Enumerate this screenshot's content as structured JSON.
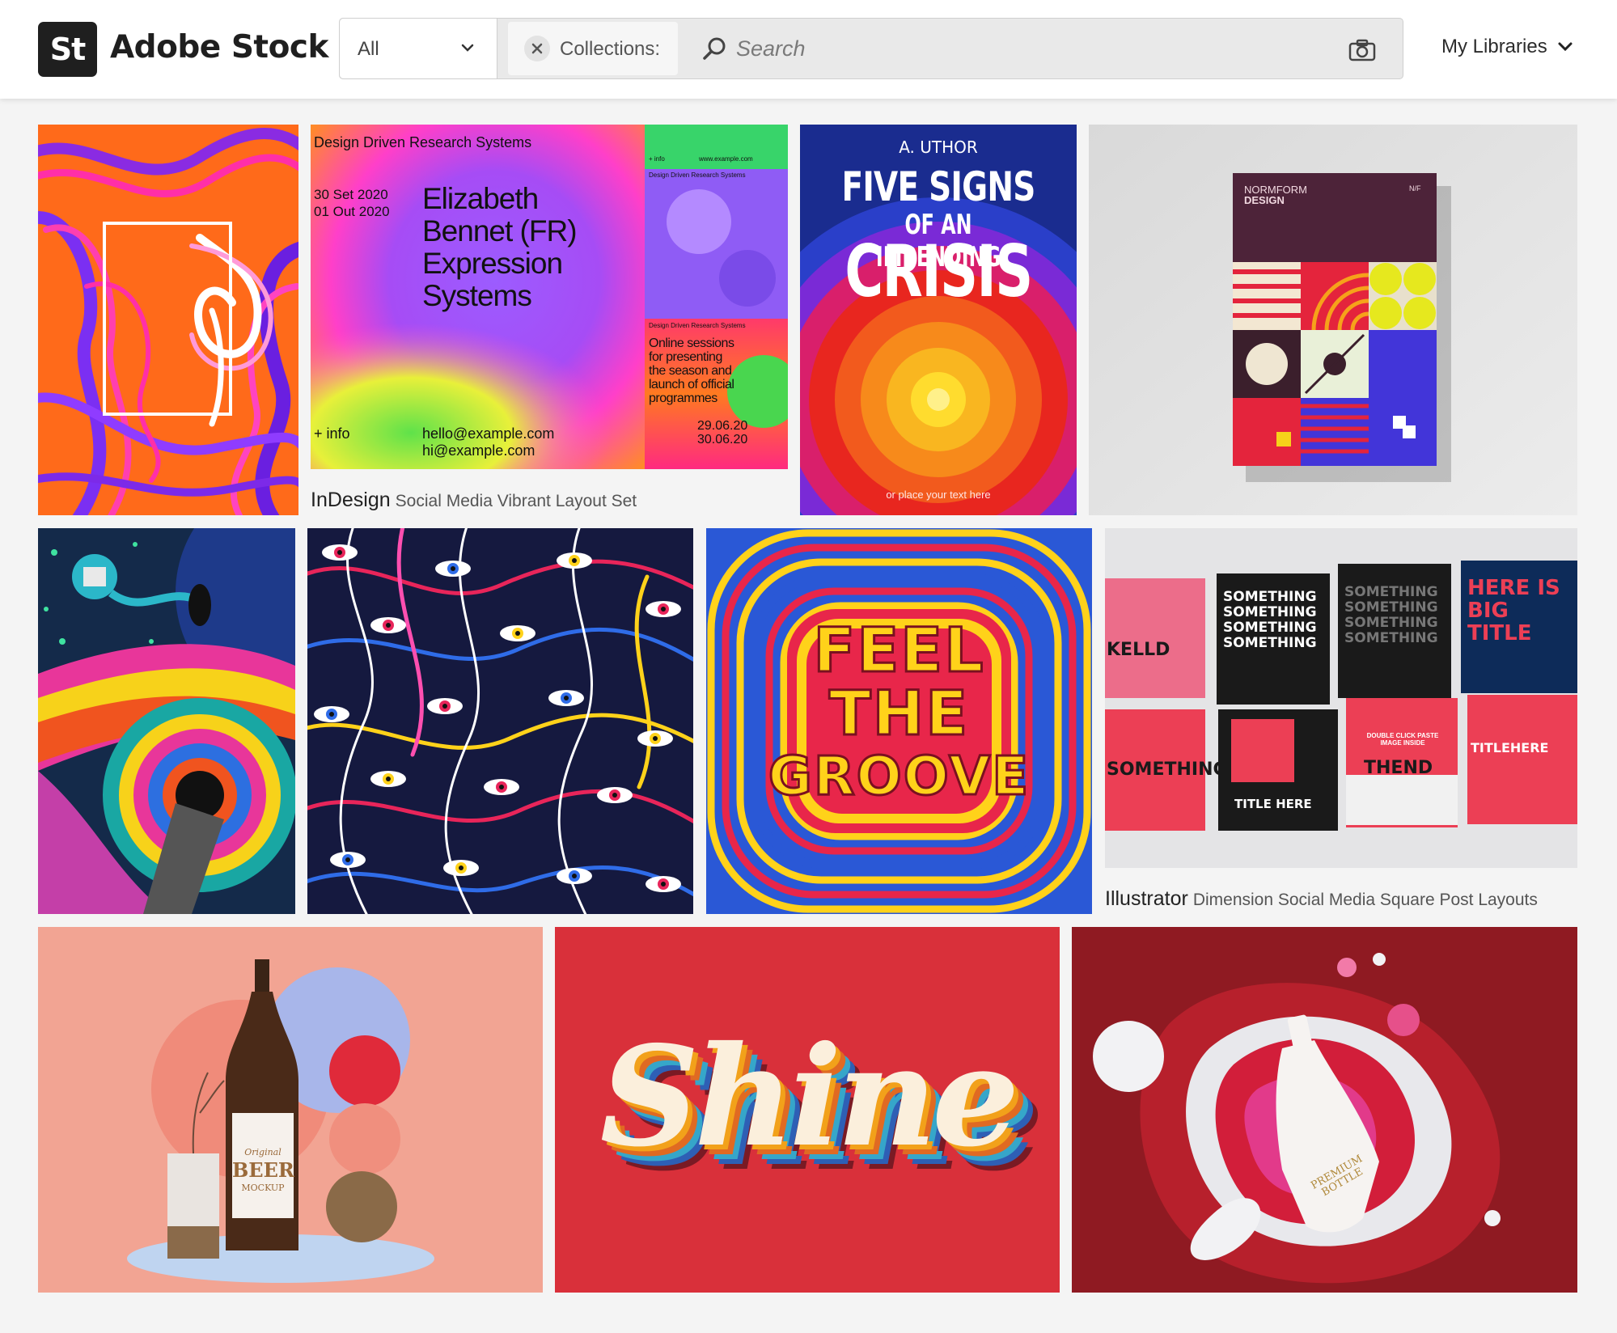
{
  "header": {
    "logo_mark": "St",
    "logo_text": "Adobe Stock",
    "scope_label": "All",
    "chip_label": "Collections:",
    "search_placeholder": "Search",
    "libraries_label": "My Libraries"
  },
  "gallery": {
    "indesign": {
      "app": "InDesign",
      "description": "Social Media Vibrant Layout Set",
      "poster": {
        "header": "Design Driven Research Systems",
        "date1": "30 Set 2020",
        "date2": "01 Out 2020",
        "name_line1": "Elizabeth",
        "name_line2": "Bennet (FR)",
        "name_line3": "Expression",
        "name_line4": "Systems",
        "info": "+ info",
        "email1": "hello@example.com",
        "email2": "hi@example.com",
        "side_small1": "+ info",
        "side_small2": "www.example.com",
        "side_header": "Design Driven Research Systems",
        "side_text1": "Online sessions",
        "side_text2": "for presenting",
        "side_text3": "the season and",
        "side_text4": "launch of official",
        "side_text5": "programmes",
        "side_date1": "29.06.20",
        "side_date2": "30.06.20"
      }
    },
    "crisis": {
      "author": "A. UTHOR",
      "line1": "FIVE SIGNS",
      "line2": "OF AN IMPENDING",
      "line3": "CRISIS",
      "footer": "or place your text here"
    },
    "normform": {
      "title1": "NORMFORM",
      "title2": "DESIGN",
      "tag": "N/F"
    },
    "groove": {
      "line1": "FEEL",
      "line2": "THE",
      "line3": "GROOVE"
    },
    "illustrator": {
      "app": "Illustrator",
      "description": "Dimension Social Media Square Post Layouts",
      "cards": {
        "c1": "KELLD",
        "c2": "SOMETHING",
        "c3": "SOMETHING",
        "c4": "HERE IS BIG TITLE",
        "c5": "SOMETHING",
        "c6": "TITLE HERE",
        "c7": "THEND",
        "c8": "TITLEHERE",
        "small": "DOUBLE CLICK PASTE IMAGE INSIDE"
      }
    },
    "beer": {
      "label1": "Original",
      "label2": "BEER",
      "label3": "MOCKUP"
    },
    "shine": {
      "word": "Shine"
    },
    "bottle": {
      "label1": "PREMIUM",
      "label2": "BOTTLE"
    }
  },
  "colors": {
    "accent": "#1f1f1f",
    "background": "#f4f4f4"
  }
}
